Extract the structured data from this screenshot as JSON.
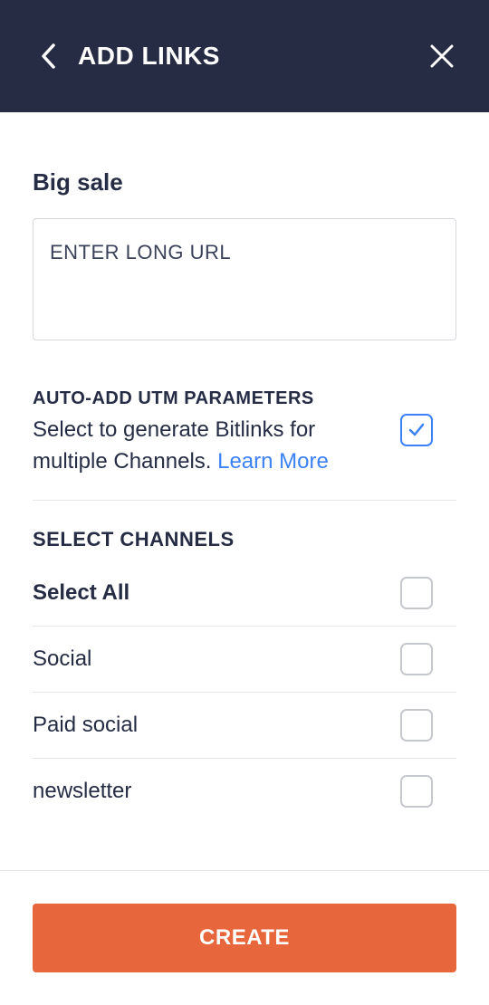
{
  "header": {
    "title": "ADD LINKS"
  },
  "campaign": {
    "title": "Big sale",
    "url_placeholder": "ENTER LONG URL"
  },
  "utm": {
    "label": "AUTO-ADD UTM PARAMETERS",
    "description_prefix": "Select to generate Bitlinks for multiple Channels. ",
    "learn_more": "Learn More",
    "checked": true
  },
  "channels": {
    "label": "SELECT CHANNELS",
    "select_all": "Select All",
    "items": [
      {
        "name": "Social"
      },
      {
        "name": "Paid social"
      },
      {
        "name": "newsletter"
      }
    ]
  },
  "footer": {
    "create_label": "CREATE"
  },
  "colors": {
    "header_bg": "#252c44",
    "accent": "#e8663c",
    "link": "#3b82f6"
  }
}
